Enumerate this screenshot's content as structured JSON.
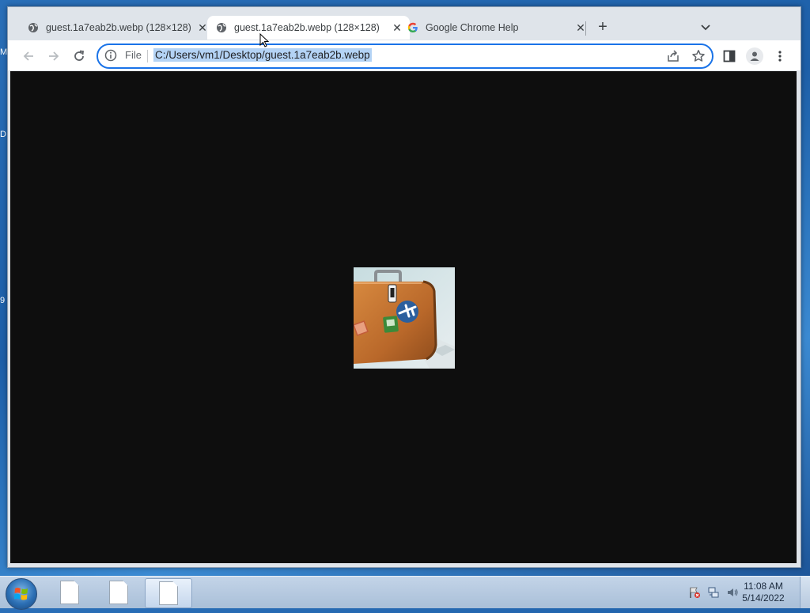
{
  "desktop": {
    "edge_letters": [
      "M",
      "D",
      "9"
    ]
  },
  "browser": {
    "tabs": [
      {
        "title": "guest.1a7eab2b.webp (128×128)",
        "favicon": "globe-icon",
        "active": false
      },
      {
        "title": "guest.1a7eab2b.webp (128×128)",
        "favicon": "globe-icon",
        "active": true
      },
      {
        "title": "Google Chrome Help",
        "favicon": "google-g-icon",
        "active": false
      }
    ],
    "omnibox": {
      "chip": "File",
      "url": "C:/Users/vm1/Desktop/guest.1a7eab2b.webp"
    },
    "content": {
      "background": "#0e0e0e",
      "image_alt": "suitcase image"
    }
  },
  "taskbar": {
    "apps": [
      "document-icon",
      "document-icon",
      "document-icon"
    ],
    "clock": {
      "time": "11:08 AM",
      "date": "5/14/2022"
    }
  },
  "colors": {
    "accent": "#1a73e8",
    "selection": "#b4d3f5"
  }
}
